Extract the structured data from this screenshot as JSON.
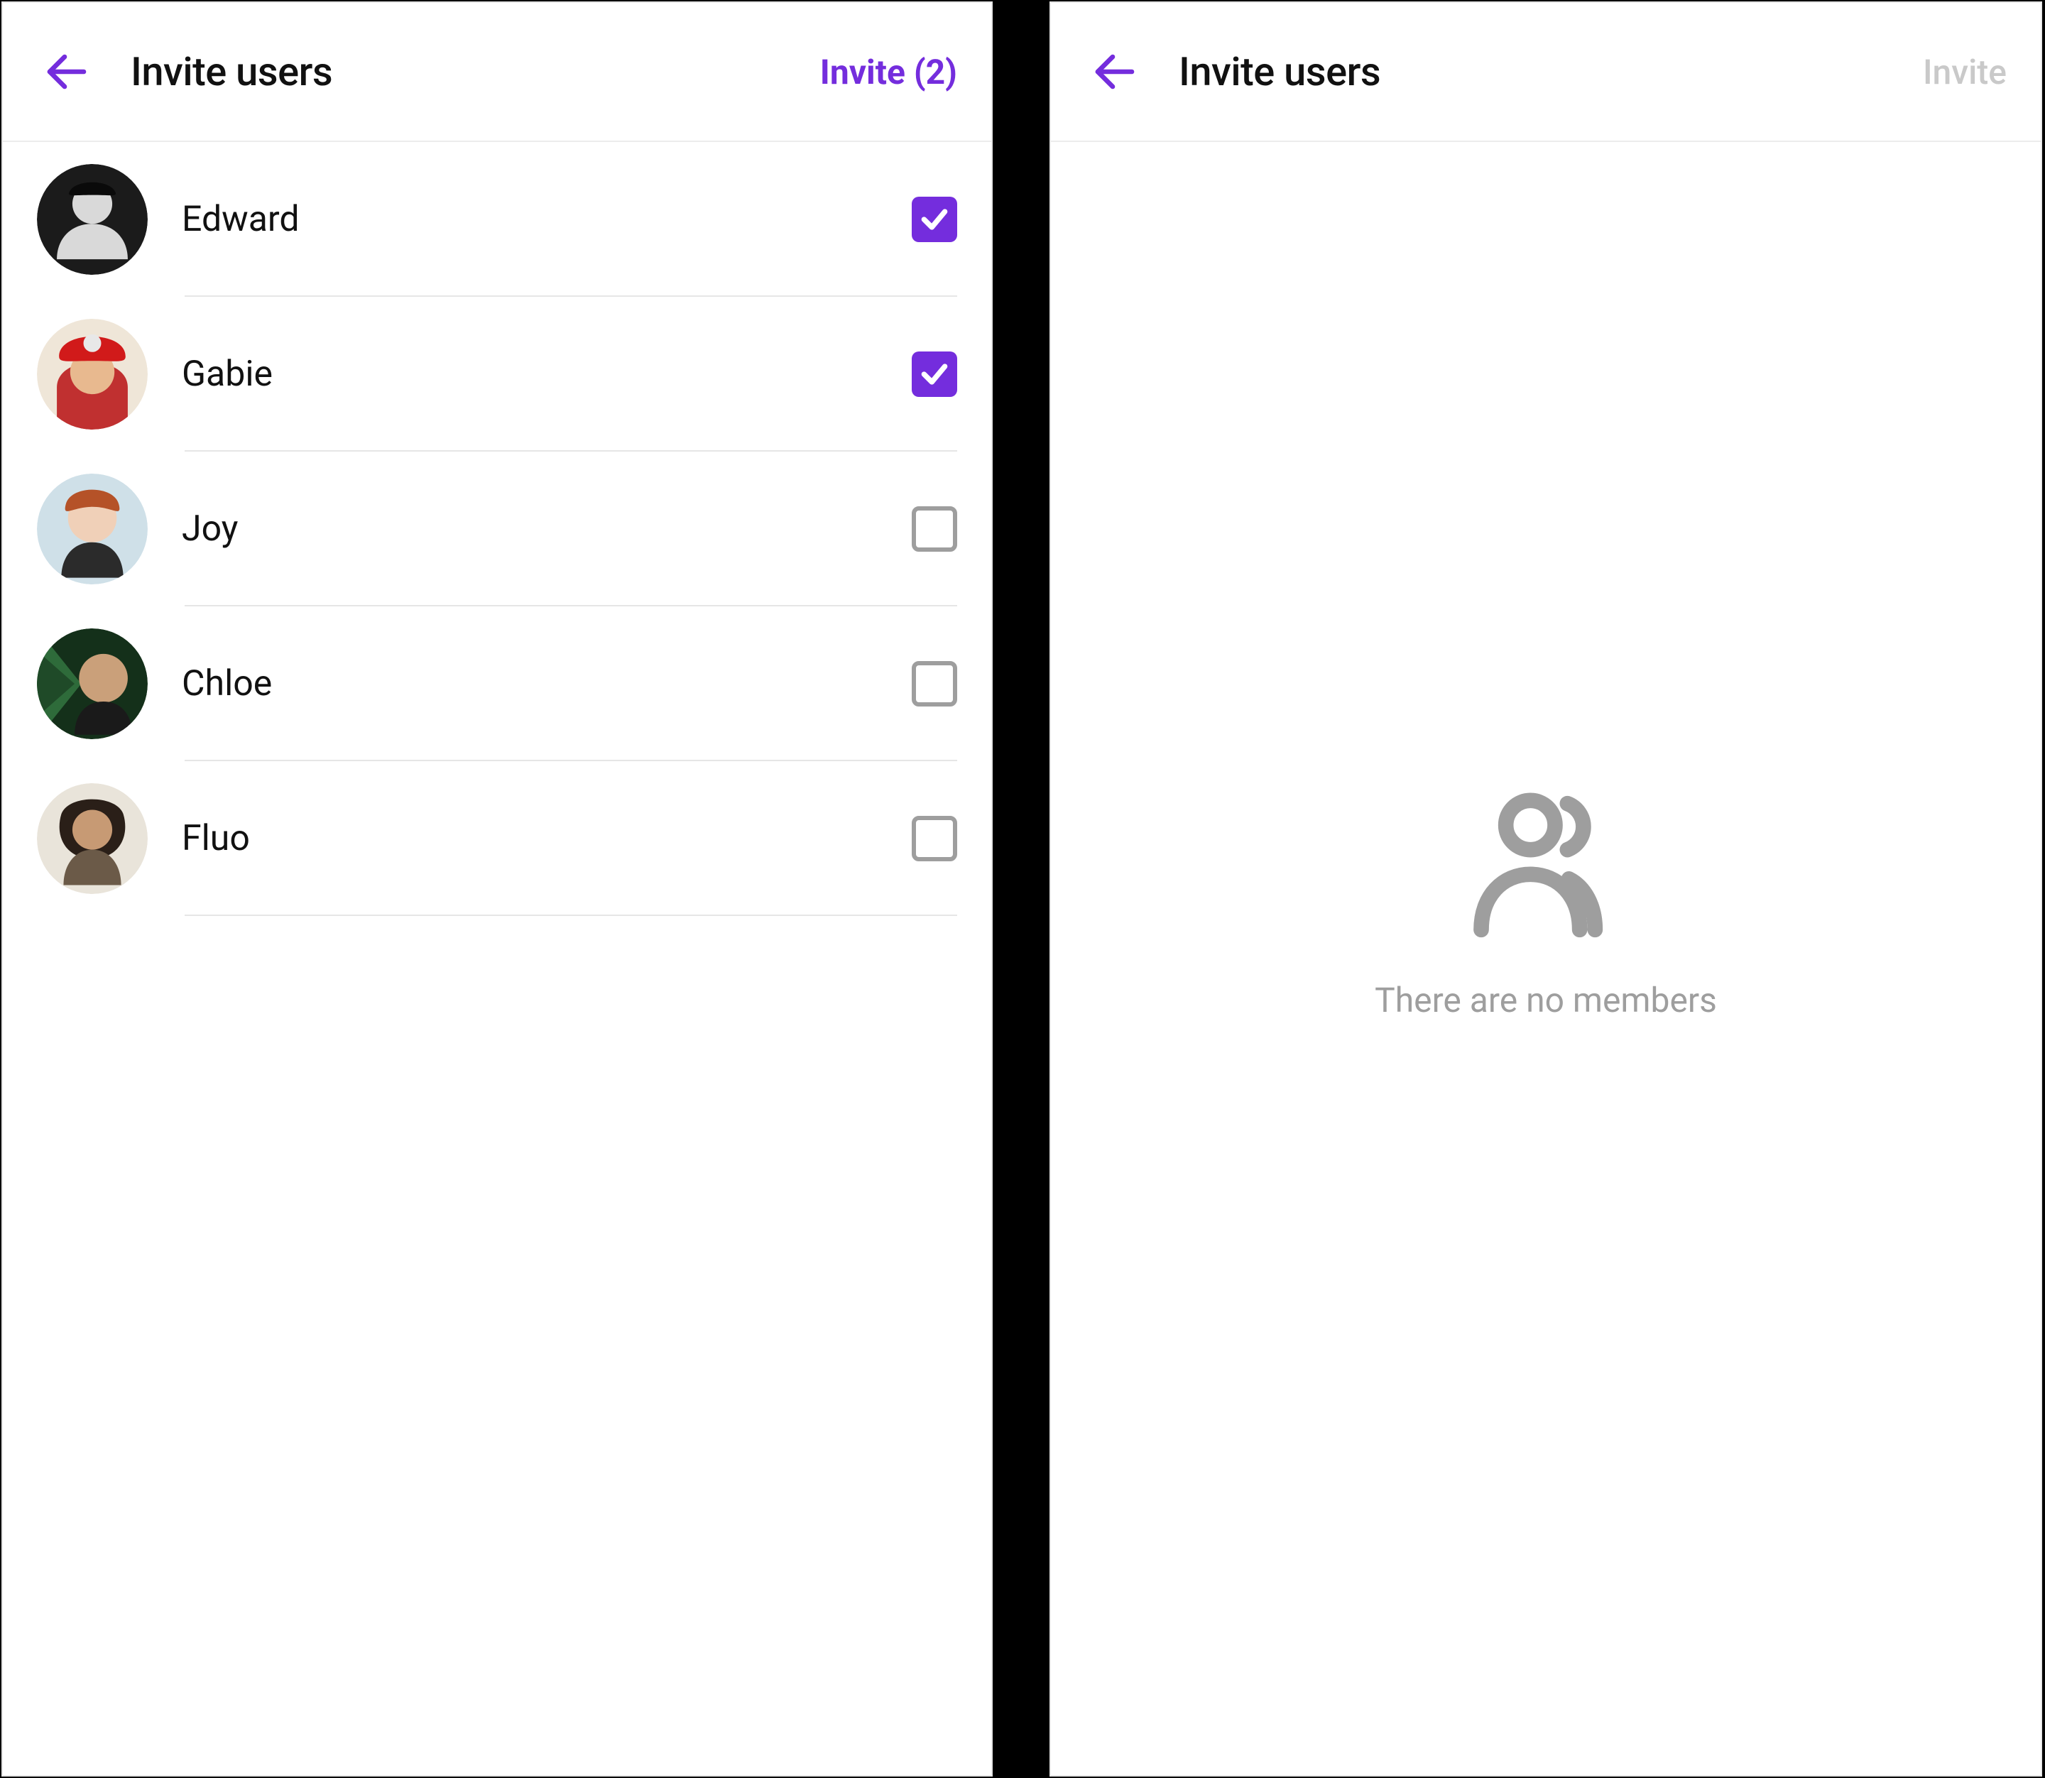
{
  "colors": {
    "accent": "#742DDD",
    "muted": "#9e9e9e",
    "border": "#e6e6e6"
  },
  "left": {
    "title": "Invite users",
    "invite_label": "Invite (2)",
    "invite_enabled": true,
    "users": [
      {
        "name": "Edward",
        "checked": true,
        "avatar_bg": "#1b1b1b"
      },
      {
        "name": "Gabie",
        "checked": true,
        "avatar_bg": "#d11a1a"
      },
      {
        "name": "Joy",
        "checked": false,
        "avatar_bg": "#c7d9e2"
      },
      {
        "name": "Chloe",
        "checked": false,
        "avatar_bg": "#2e6b3a"
      },
      {
        "name": "Fluo",
        "checked": false,
        "avatar_bg": "#bfa98d"
      }
    ]
  },
  "right": {
    "title": "Invite users",
    "invite_label": "Invite",
    "invite_enabled": false,
    "empty_message": "There are no members"
  }
}
